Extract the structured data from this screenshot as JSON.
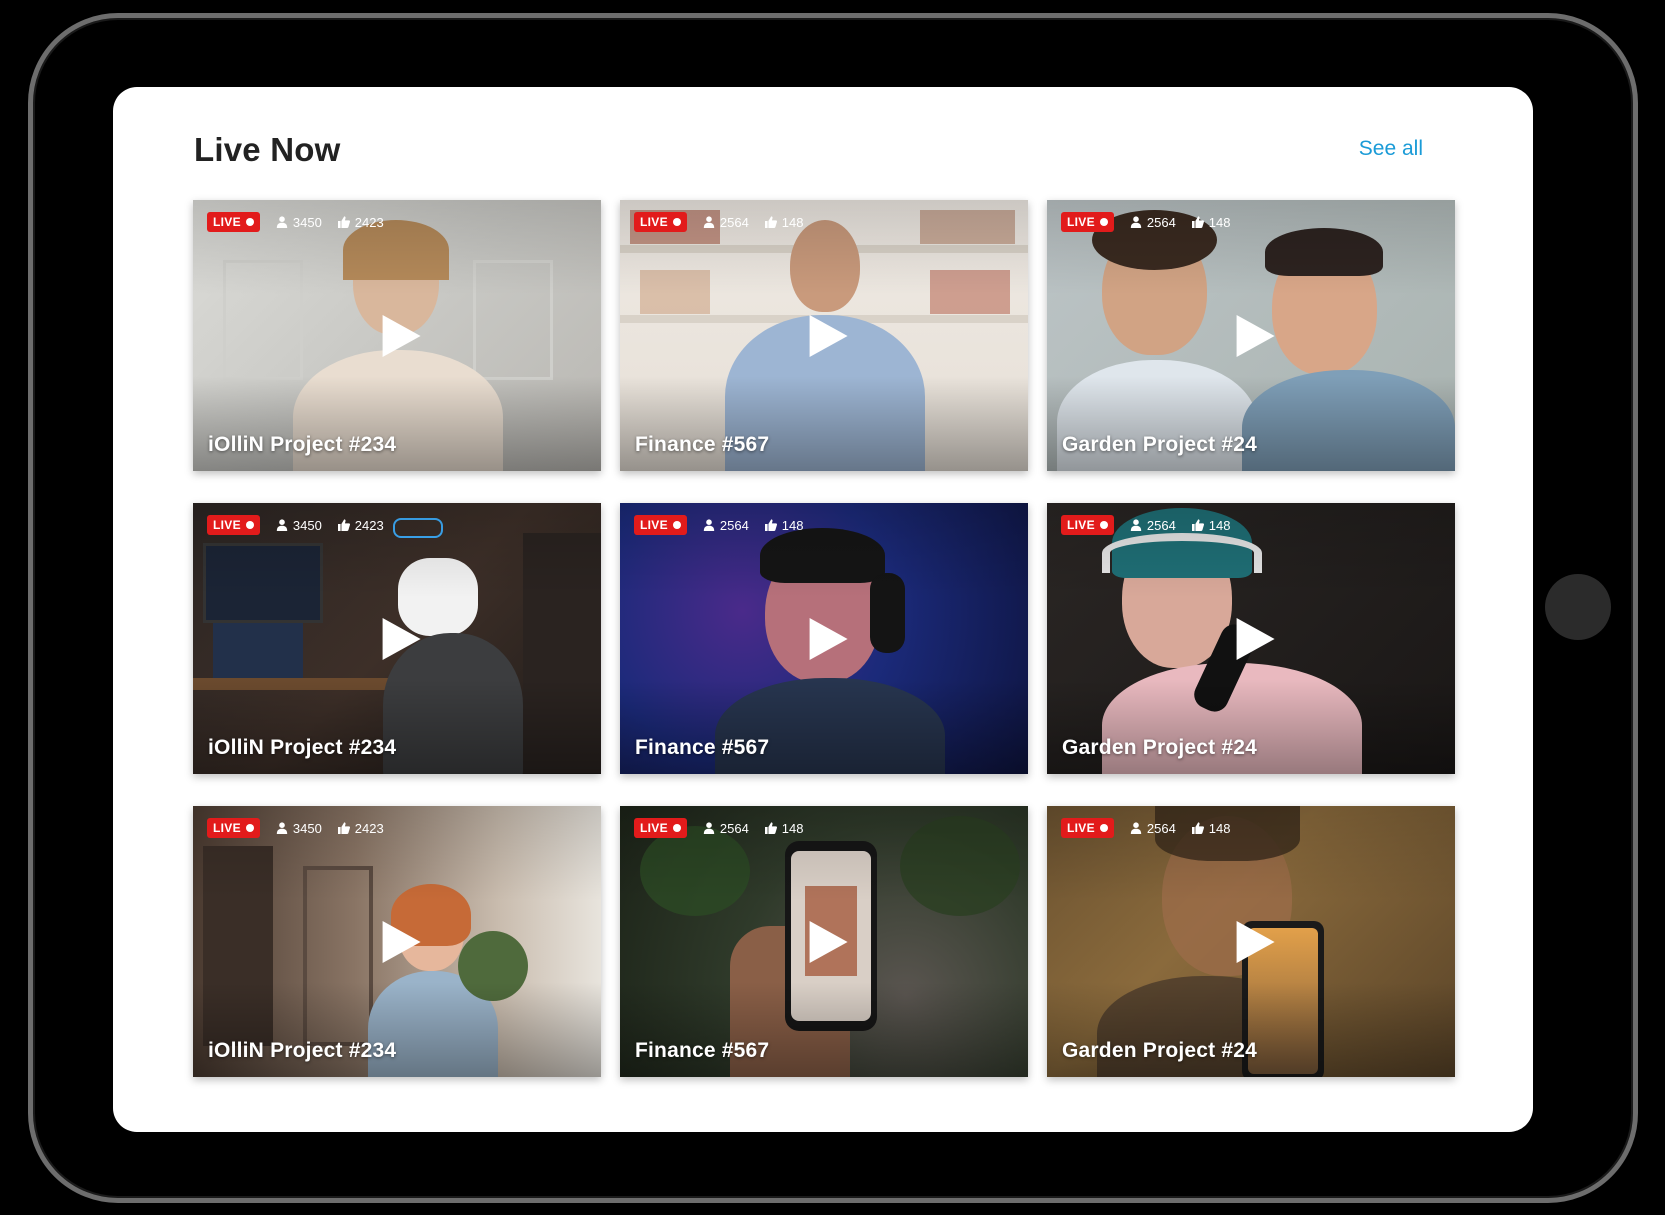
{
  "section": {
    "title": "Live Now",
    "see_all": "See all"
  },
  "live_label": "LIVE",
  "icons": {
    "viewers": "user-icon",
    "likes": "thumbs-up-icon",
    "play": "play-icon"
  },
  "cards": [
    {
      "title": "iOlliN Project #234",
      "viewers": "3450",
      "likes": "2423"
    },
    {
      "title": "Finance #567",
      "viewers": "2564",
      "likes": "148"
    },
    {
      "title": "Garden Project #24",
      "viewers": "2564",
      "likes": "148"
    },
    {
      "title": "iOlliN Project #234",
      "viewers": "3450",
      "likes": "2423"
    },
    {
      "title": "Finance #567",
      "viewers": "2564",
      "likes": "148"
    },
    {
      "title": "Garden Project #24",
      "viewers": "2564",
      "likes": "148"
    },
    {
      "title": "iOlliN Project #234",
      "viewers": "3450",
      "likes": "2423"
    },
    {
      "title": "Finance #567",
      "viewers": "2564",
      "likes": "148"
    },
    {
      "title": "Garden Project #24",
      "viewers": "2564",
      "likes": "148"
    }
  ],
  "colors": {
    "accent": "#1a9bd7",
    "live": "#e21b1b",
    "title": "#222222"
  }
}
